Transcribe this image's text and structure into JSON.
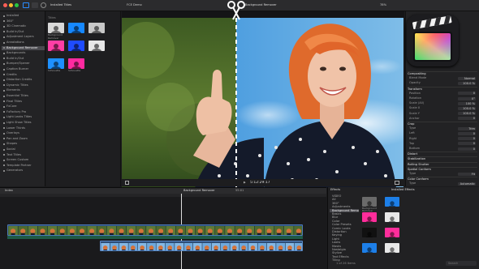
{
  "browser": {
    "title": "Installed Titles",
    "section_label": "Titles",
    "thumbs": [
      {
        "label": "Background Remover",
        "color": "#d9d9d9"
      },
      {
        "label": "",
        "color": "#1688ff"
      },
      {
        "label": "",
        "color": "#c8c8c8"
      },
      {
        "label": "",
        "color": "#ff3ea5"
      },
      {
        "label": "",
        "color": "#1f4cff"
      },
      {
        "label": "",
        "color": "#e7e7e7"
      },
      {
        "label": "Silhouette",
        "color": "#1e90ff"
      },
      {
        "label": "Silhouette",
        "color": "#ff2aa0"
      }
    ]
  },
  "sidebar": {
    "items": [
      {
        "label": "Installed"
      },
      {
        "label": "360°"
      },
      {
        "label": "3D Cinematic"
      },
      {
        "label": "Build In/Out"
      },
      {
        "label": "Adjustment Layers"
      },
      {
        "label": "Annotations"
      },
      {
        "label": "Background Remover"
      },
      {
        "label": "Backgrounds"
      },
      {
        "label": "Build In/Out"
      },
      {
        "label": "Bumper/Opener"
      },
      {
        "label": "Caption Burner"
      },
      {
        "label": "Credits"
      },
      {
        "label": "Distortion Credits"
      },
      {
        "label": "Dynamic Titles"
      },
      {
        "label": "Elements"
      },
      {
        "label": "Essential Titles"
      },
      {
        "label": "Final Titles"
      },
      {
        "label": "FxCore"
      },
      {
        "label": "FxFactory Pro"
      },
      {
        "label": "Light Leaks Titles"
      },
      {
        "label": "Light Show Titles"
      },
      {
        "label": "Lower Thirds"
      },
      {
        "label": "Overlays"
      },
      {
        "label": "Pan and Zoom"
      },
      {
        "label": "Shapes"
      },
      {
        "label": "Social"
      },
      {
        "label": "Text Titles"
      },
      {
        "label": "Screen Custom"
      },
      {
        "label": "Template Partner"
      },
      {
        "label": "Generators"
      }
    ],
    "selected_index": 6
  },
  "viewer": {
    "title_left": "FCE Demo",
    "title_center": "Background Remover",
    "zoom": "78%",
    "timecode": "5:12:29:17"
  },
  "inspector": {
    "rows": [
      {
        "label": "Compositing",
        "head": true
      },
      {
        "label": "Blend Mode",
        "value": "Normal"
      },
      {
        "label": "Opacity",
        "value": "100.0 %"
      },
      {
        "label": "Transform",
        "head": true
      },
      {
        "label": "Position",
        "value": "0"
      },
      {
        "label": "Rotation",
        "value": "0°"
      },
      {
        "label": "Scale (All)",
        "value": "100 %"
      },
      {
        "label": "Scale X",
        "value": "100.0 %"
      },
      {
        "label": "Scale Y",
        "value": "100.0 %"
      },
      {
        "label": "Anchor",
        "value": "0"
      },
      {
        "label": "Crop",
        "head": true
      },
      {
        "label": "Type",
        "value": "Trim"
      },
      {
        "label": "Left",
        "value": "0"
      },
      {
        "label": "Right",
        "value": "0"
      },
      {
        "label": "Top",
        "value": "0"
      },
      {
        "label": "Bottom",
        "value": "0"
      },
      {
        "label": "Distort",
        "head": true
      },
      {
        "label": "Stabilization",
        "head": true
      },
      {
        "label": "Rolling Shutter",
        "head": true
      },
      {
        "label": "Spatial Conform",
        "head": true
      },
      {
        "label": "Type",
        "value": "Fit"
      },
      {
        "label": "Color Conform",
        "head": true
      },
      {
        "label": "Type",
        "value": "Automatic"
      }
    ]
  },
  "timeline": {
    "index_label": "Index",
    "project_name": "Background Remover",
    "duration": "55:01"
  },
  "effects": {
    "title": "Effects",
    "installed_label": "Installed Effects",
    "categories": [
      {
        "label": "VIDEO"
      },
      {
        "label": "All"
      },
      {
        "label": "360°"
      },
      {
        "label": "Adjustments"
      },
      {
        "label": "Background Remover"
      },
      {
        "label": "Basics"
      },
      {
        "label": "Blur"
      },
      {
        "label": "Color"
      },
      {
        "label": "Color Presets"
      },
      {
        "label": "Comic Looks"
      },
      {
        "label": "Distortion"
      },
      {
        "label": "Keying"
      },
      {
        "label": "Light"
      },
      {
        "label": "Looks"
      },
      {
        "label": "Masks"
      },
      {
        "label": "Nostalgia"
      },
      {
        "label": "Stylize"
      },
      {
        "label": "Text Effects"
      },
      {
        "label": "Tiling"
      }
    ],
    "selected_index": 4,
    "thumbs": [
      {
        "label": "Background Remover",
        "color": "#6a6a6a"
      },
      {
        "label": "",
        "color": "#1d7fe8"
      },
      {
        "label": "",
        "color": "#ff2d9b"
      },
      {
        "label": "",
        "color": "#e8e8e8"
      },
      {
        "label": "",
        "color": "#111111"
      },
      {
        "label": "",
        "color": "#ff2d9b"
      },
      {
        "label": "",
        "color": "#1d7fe8"
      },
      {
        "label": "",
        "color": "#e8e8e8"
      }
    ],
    "search_placeholder": "Search",
    "item_count": "1 of 26 Items"
  },
  "colors": {
    "accent": "#2a8cff",
    "dress": "#141a2a",
    "hair": "#e0602a",
    "sky": "#7ab8e8"
  }
}
